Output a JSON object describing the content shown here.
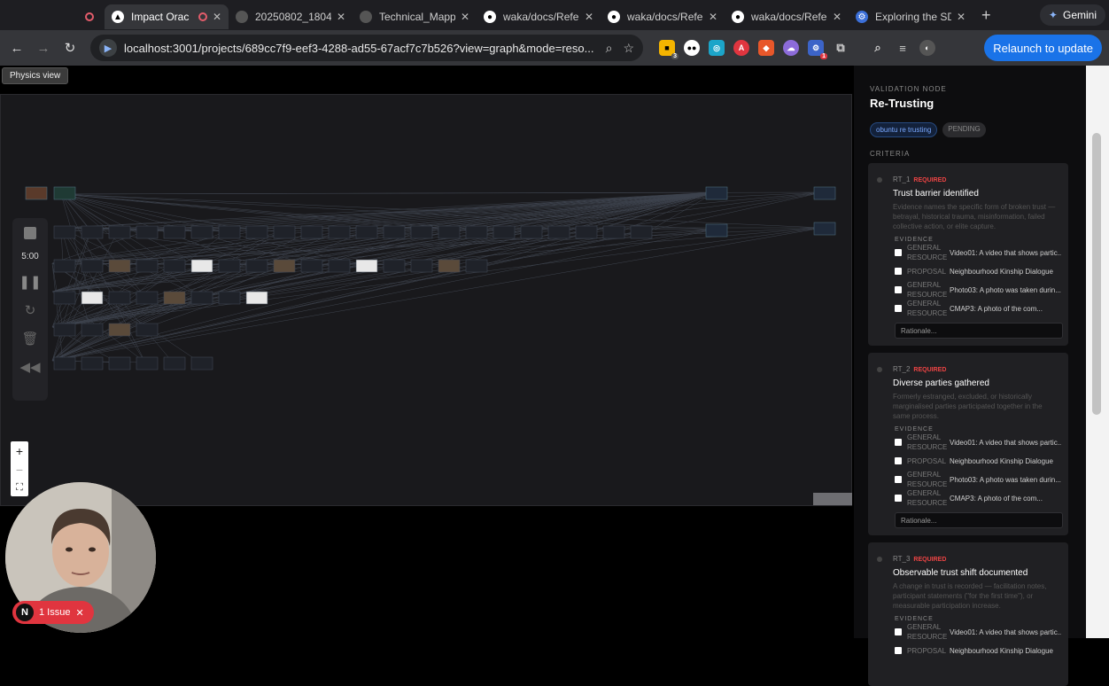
{
  "browser": {
    "tabs": [
      {
        "title": "",
        "icon": "record-icon",
        "active": false
      },
      {
        "title": "Impact Orac",
        "icon": "triangle-icon",
        "active": true,
        "recording": true
      },
      {
        "title": "20250802_1804",
        "icon": "globe-icon",
        "active": false
      },
      {
        "title": "Technical_Mapp",
        "icon": "globe-icon",
        "active": false
      },
      {
        "title": "waka/docs/Refe",
        "icon": "github-icon",
        "active": false
      },
      {
        "title": "waka/docs/Refe",
        "icon": "github-icon",
        "active": false
      },
      {
        "title": "waka/docs/Refe",
        "icon": "github-icon",
        "active": false
      },
      {
        "title": "Exploring the SD",
        "icon": "gear-icon",
        "active": false
      }
    ],
    "gemini_label": "Gemini",
    "url": "localhost:3001/projects/689cc7f9-eef3-4288-ad55-67acf7c7b526?view=graph&mode=reso...",
    "relaunch_label": "Relaunch to update",
    "extension_badges": [
      "3",
      "1"
    ]
  },
  "tooltip": "Physics view",
  "graph": {
    "timer": "5:00",
    "zoom_in": "+",
    "zoom_out": "−",
    "fit": "⛶"
  },
  "issue_badge": {
    "initial": "N",
    "label": "1 Issue"
  },
  "sidebar": {
    "label": "VALIDATION NODE",
    "title": "Re-Trusting",
    "chips": [
      "obuntu re trusting",
      "PENDING"
    ],
    "criteria_label": "CRITERIA",
    "evidence_label": "EVIDENCE",
    "rationale_placeholder": "Rationale...",
    "criteria": [
      {
        "code": "RT_1",
        "required": "REQUIRED",
        "title": "Trust barrier identified",
        "description": "Evidence names the specific form of broken trust — betrayal, historical trauma, misinformation, failed collective action, or elite capture.",
        "evidence": [
          {
            "type": "GENERAL RESOURCE",
            "name": "Video01: A video that shows partic..."
          },
          {
            "type": "PROPOSAL",
            "name": "Neighbourhood Kinship Dialogue"
          },
          {
            "type": "GENERAL RESOURCE",
            "name": "Photo03: A photo was taken durin..."
          },
          {
            "type": "GENERAL RESOURCE",
            "name": "CMAP3: A photo of the com..."
          }
        ]
      },
      {
        "code": "RT_2",
        "required": "REQUIRED",
        "title": "Diverse parties gathered",
        "description": "Formerly estranged, excluded, or historically marginalised parties participated together in the same process.",
        "evidence": [
          {
            "type": "GENERAL RESOURCE",
            "name": "Video01: A video that shows partic..."
          },
          {
            "type": "PROPOSAL",
            "name": "Neighbourhood Kinship Dialogue"
          },
          {
            "type": "GENERAL RESOURCE",
            "name": "Photo03: A photo was taken durin..."
          },
          {
            "type": "GENERAL RESOURCE",
            "name": "CMAP3: A photo of the com..."
          }
        ]
      },
      {
        "code": "RT_3",
        "required": "REQUIRED",
        "title": "Observable trust shift documented",
        "description": "A change in trust is recorded — facilitation notes, participant statements (\"for the first time\"), or measurable participation increase.",
        "evidence": [
          {
            "type": "GENERAL RESOURCE",
            "name": "Video01: A video that shows partic..."
          },
          {
            "type": "PROPOSAL",
            "name": "Neighbourhood Kinship Dialogue"
          }
        ]
      }
    ]
  },
  "colors": {
    "accent": "#1a73e8",
    "required": "#e44444",
    "issue": "#e0353f"
  }
}
